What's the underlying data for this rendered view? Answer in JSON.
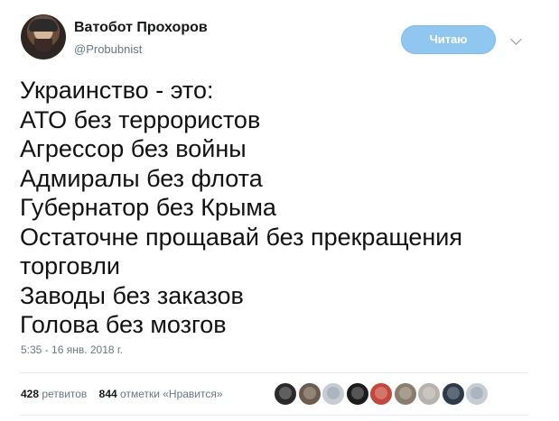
{
  "user": {
    "name": "Ватобот Прохоров",
    "handle": "@Probubnist"
  },
  "follow_button": {
    "label": "Читаю"
  },
  "tweet": {
    "lines": [
      "Украинство - это:",
      "АТО без террористов",
      "Агрессор без войны",
      "Адмиралы без флота",
      "Губернатор без Крыма",
      "Остаточне прощавай без прекращения",
      "торговли",
      "Заводы без заказов",
      "Голова без мозгов"
    ],
    "timestamp": "5:35 - 16 янв. 2018 г."
  },
  "stats": {
    "retweets_count": "428",
    "retweets_label": "ретвитов",
    "likes_count": "844",
    "likes_label": "отметки «Нравится»"
  },
  "liked_by_avatars": [
    {
      "icon": "user-avatar",
      "color": "#2a2a2a"
    },
    {
      "icon": "user-avatar",
      "color": "#6d5c4d"
    },
    {
      "icon": "default-avatar",
      "color": "#c6ccd2"
    },
    {
      "icon": "user-avatar",
      "color": "#1c1c1c"
    },
    {
      "icon": "user-avatar",
      "color": "#c4473a"
    },
    {
      "icon": "user-avatar",
      "color": "#8a7d6e"
    },
    {
      "icon": "user-avatar",
      "color": "#b8b2ac"
    },
    {
      "icon": "user-avatar",
      "color": "#2c3a4b"
    },
    {
      "icon": "default-avatar",
      "color": "#c6ccd2"
    }
  ],
  "colors": {
    "follow_button_bg": "#8fc7f0",
    "secondary_text": "#657786"
  }
}
